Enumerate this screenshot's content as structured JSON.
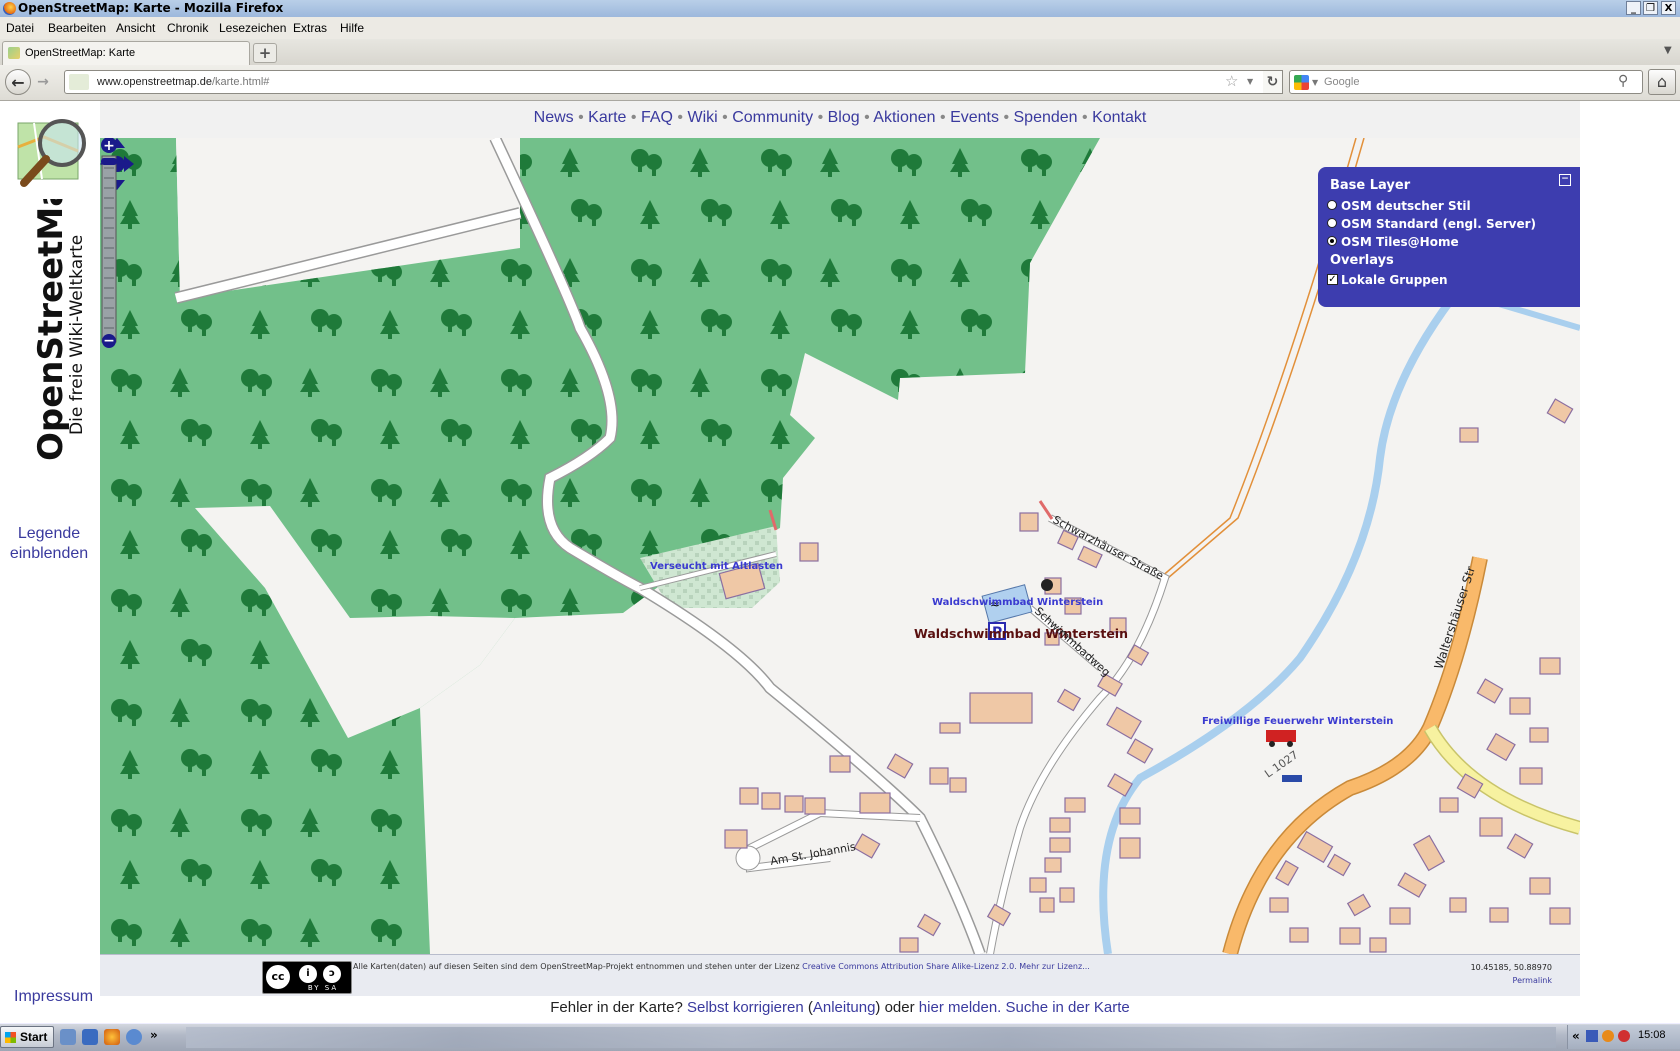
{
  "window": {
    "title": "OpenStreetMap: Karte - Mozilla Firefox",
    "controls": [
      "_",
      "❐",
      "X"
    ]
  },
  "menu": [
    "Datei",
    "Bearbeiten",
    "Ansicht",
    "Chronik",
    "Lesezeichen",
    "Extras",
    "Hilfe"
  ],
  "tab": {
    "label": "OpenStreetMap: Karte",
    "new_tab": "+"
  },
  "urlbar": {
    "host": "www.openstreetmap.de",
    "path": "/karte.html#"
  },
  "search": {
    "placeholder": "Google"
  },
  "site": {
    "brand_title": "OpenStreetMap",
    "brand_subtitle": "Die freie Wiki-Weltkarte",
    "nav": [
      "News",
      "Karte",
      "FAQ",
      "Wiki",
      "Community",
      "Blog",
      "Aktionen",
      "Events",
      "Spenden",
      "Kontakt"
    ],
    "nav_separator": "•",
    "legend_link": "Legende einblenden",
    "impressum": "Impressum"
  },
  "map": {
    "labels": {
      "altlasten": "Verseucht mit Altlasten",
      "freibad_small": "Waldschwimmbad Winterstein",
      "freibad_big": "Waldschwimmbad Winterstein",
      "street_schwarzhaeuser": "Schwarzhäuser Straße",
      "street_schwimmbadweg": "Schwimmbadweg",
      "street_waltershaeuser": "Waltershäuser Str",
      "street_am_st_johannis": "Am St. Johannis",
      "feuerwehr": "Freiwillige Feuerwehr Winterstein",
      "road_number": "L 1027"
    },
    "parking_symbol": "P"
  },
  "layers": {
    "base_heading": "Base Layer",
    "base_options": [
      "OSM deutscher Stil",
      "OSM Standard (engl. Server)",
      "OSM Tiles@Home"
    ],
    "selected_base": 2,
    "overlays_heading": "Overlays",
    "overlay_option": "Lokale Gruppen",
    "overlay_checked": true
  },
  "footer": {
    "license_prefix": "Alle Karten(daten) auf diesen Seiten sind dem OpenStreetMap-Projekt entnommen und stehen unter der Lizenz",
    "license_link": "Creative Commons Attribution Share Alike-Lizenz 2.0.",
    "license_more": "Mehr zur Lizenz...",
    "cc_badge": {
      "cc": "cc",
      "by": "i",
      "sa": "ↄ",
      "label": "BY SA"
    },
    "coordinates": "10.45185, 50.88970",
    "permalink": "Permalink"
  },
  "error_line": {
    "prefix": "Fehler in der Karte?",
    "self_correct": "Selbst korrigieren",
    "guide": "Anleitung",
    "or": "oder",
    "report": "hier melden.",
    "search": "Suche in der Karte"
  },
  "taskbar": {
    "start": "Start",
    "clock": "15:08",
    "tray_expand": "«"
  }
}
